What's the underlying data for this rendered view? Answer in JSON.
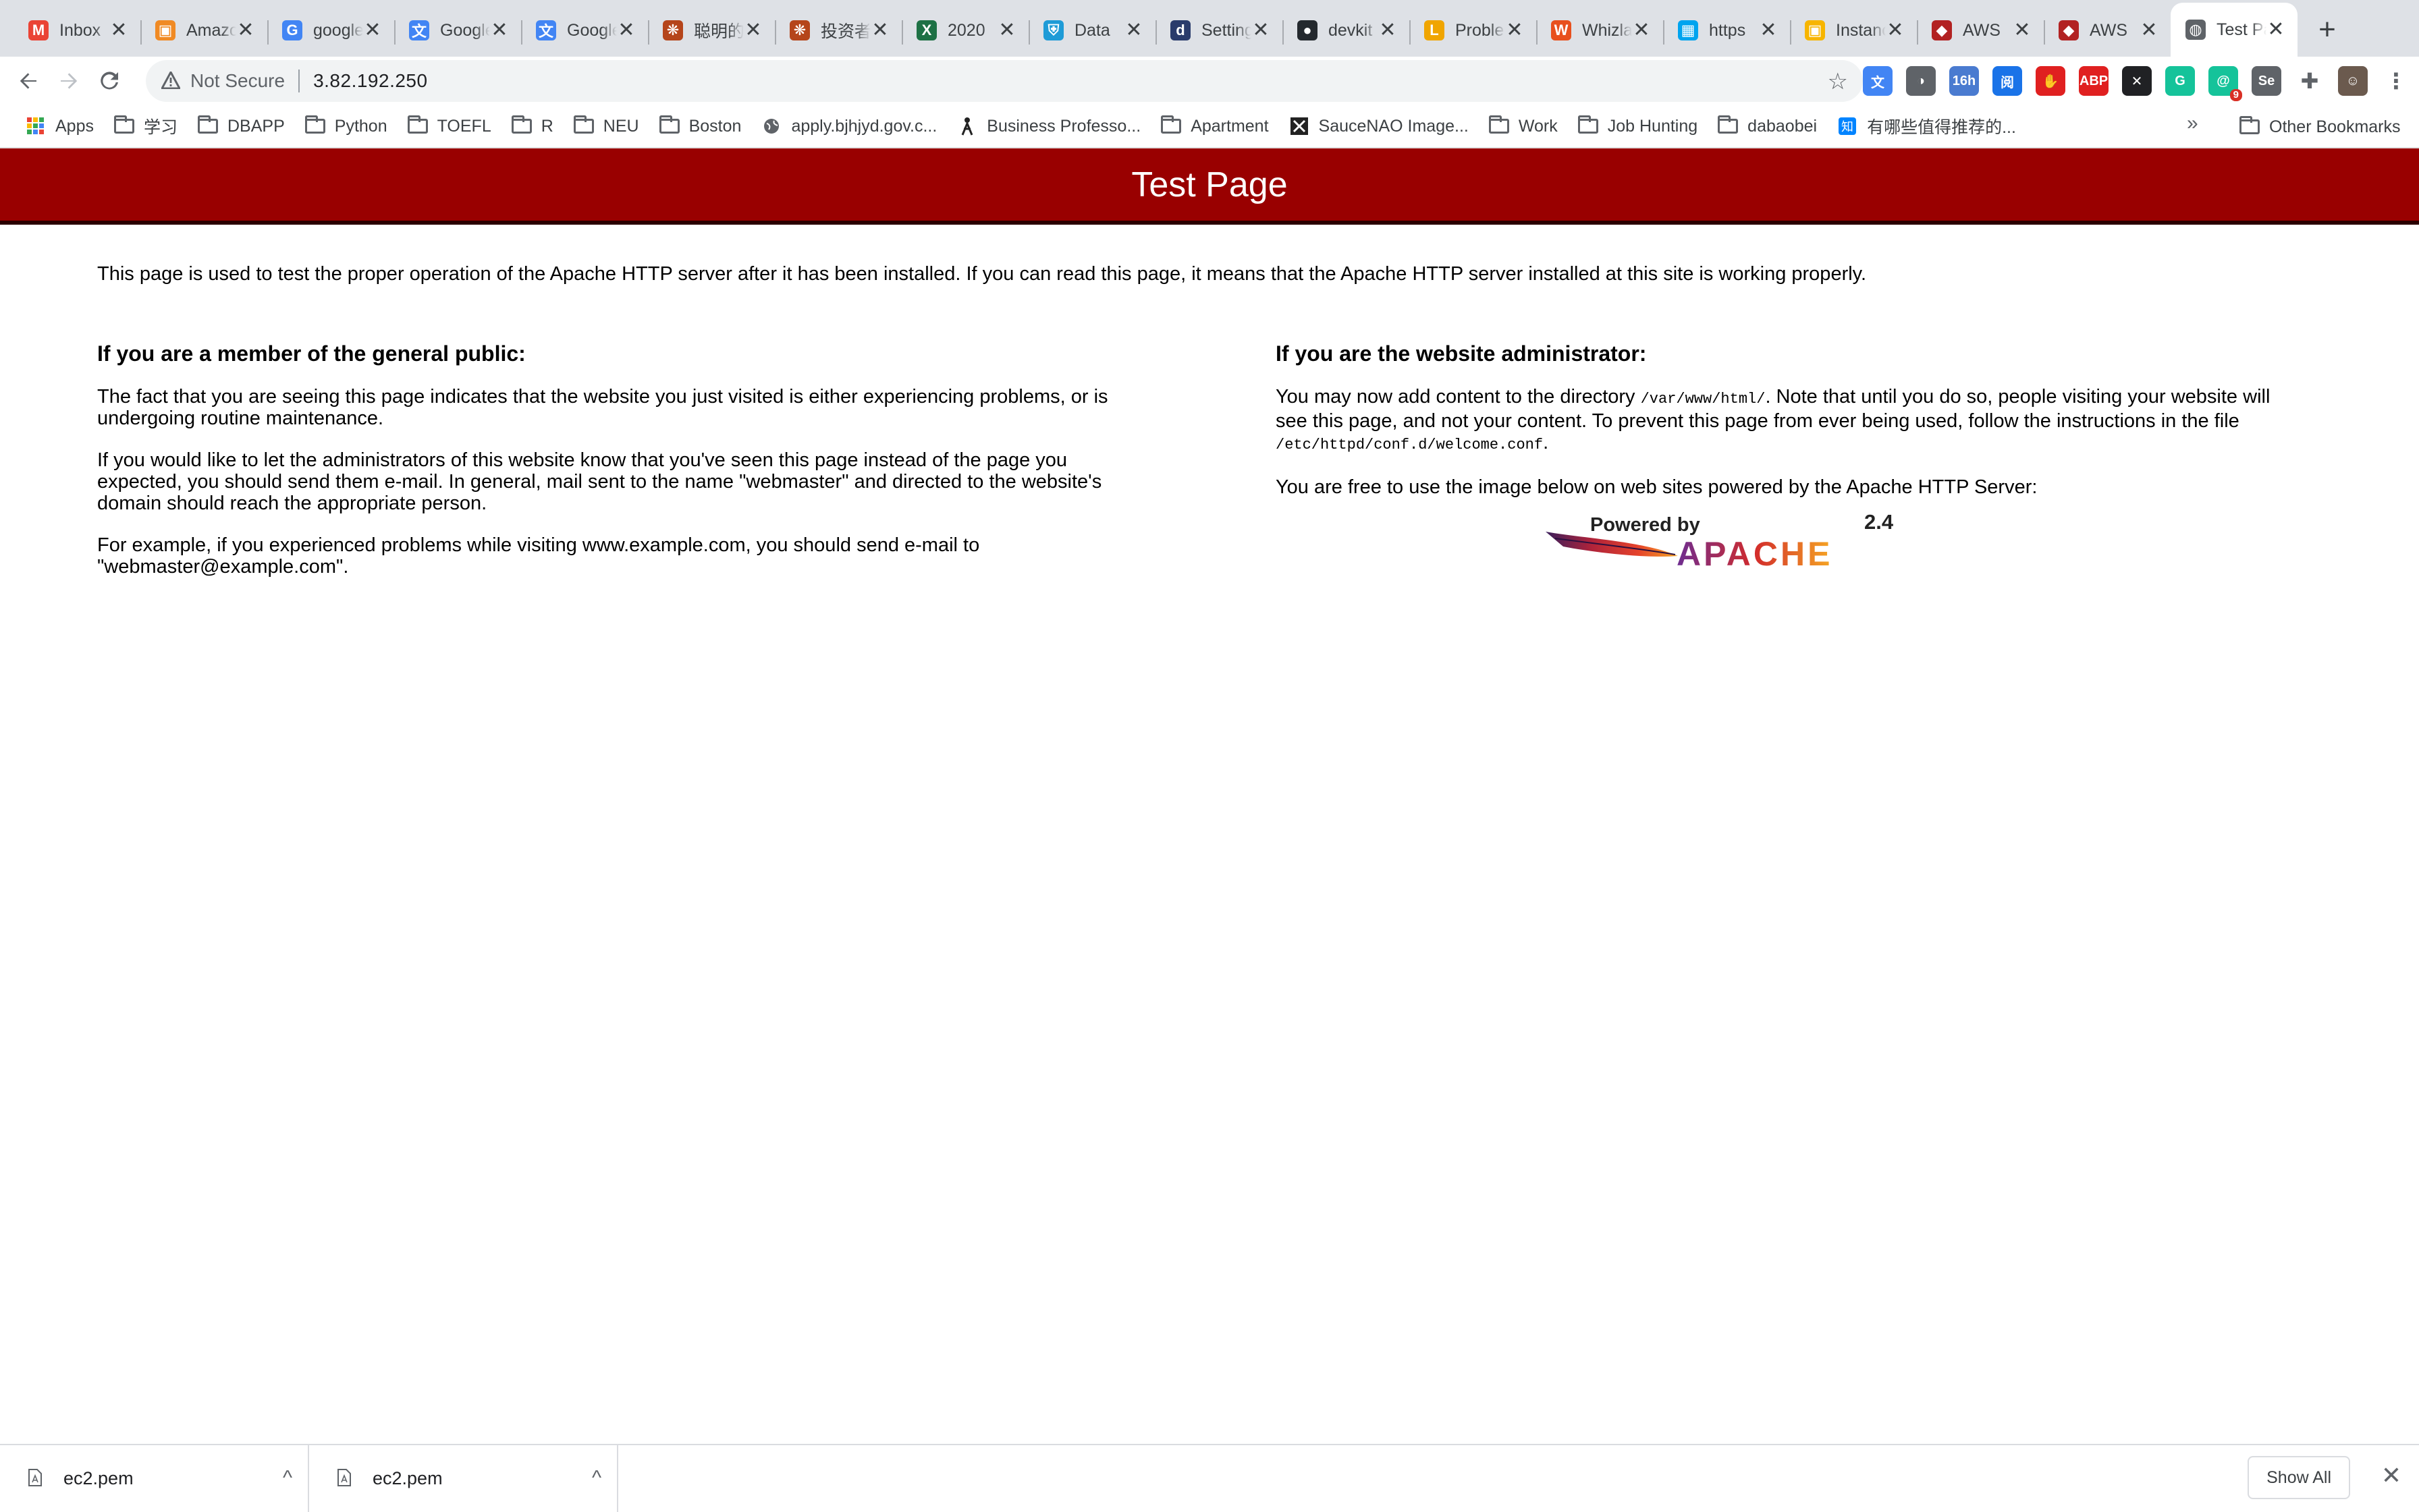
{
  "browser": {
    "tabs": [
      {
        "title": "Inbox",
        "icon": "gmail-icon",
        "color": "#ea4335",
        "glyph": "M"
      },
      {
        "title": "Amazon",
        "icon": "aws-box-icon",
        "color": "#f08a24",
        "glyph": "▣"
      },
      {
        "title": "google",
        "icon": "google-icon",
        "color": "#4285f4",
        "glyph": "G"
      },
      {
        "title": "Google Translate",
        "icon": "translate-icon",
        "color": "#4285f4",
        "glyph": "文"
      },
      {
        "title": "Google Translate",
        "icon": "translate-icon",
        "color": "#4285f4",
        "glyph": "文"
      },
      {
        "title": "聪明的投资者",
        "icon": "snowball-icon",
        "color": "#b5451b",
        "glyph": "❋"
      },
      {
        "title": "投资者",
        "icon": "snowball-icon",
        "color": "#b5451b",
        "glyph": "❋"
      },
      {
        "title": "2020",
        "icon": "excel-icon",
        "color": "#1e7145",
        "glyph": "X"
      },
      {
        "title": "Data",
        "icon": "shield-icon",
        "color": "#1e9bd7",
        "glyph": "⛨"
      },
      {
        "title": "Settings",
        "icon": "settings-icon",
        "color": "#2a3b6b",
        "glyph": "d"
      },
      {
        "title": "devkit",
        "icon": "github-icon",
        "color": "#24292e",
        "glyph": "●"
      },
      {
        "title": "Problems",
        "icon": "leetcode-icon",
        "color": "#f0a500",
        "glyph": "L"
      },
      {
        "title": "Whizlabs",
        "icon": "whizlabs-icon",
        "color": "#e8501d",
        "glyph": "W"
      },
      {
        "title": "https",
        "icon": "windows-icon",
        "color": "#00a4ef",
        "glyph": "▦"
      },
      {
        "title": "Instances",
        "icon": "cube-icon",
        "color": "#f7b500",
        "glyph": "▣"
      },
      {
        "title": "AWS",
        "icon": "aws-icon",
        "color": "#b22222",
        "glyph": "◆"
      },
      {
        "title": "AWS",
        "icon": "aws-icon",
        "color": "#b22222",
        "glyph": "◆"
      },
      {
        "title": "Test Page",
        "icon": "globe-icon",
        "color": "#5f6368",
        "glyph": "◍"
      }
    ],
    "new_tab_glyph": "+",
    "close_glyph": "✕",
    "address": {
      "security_label": "Not Secure",
      "url": "3.82.192.250"
    },
    "extensions": [
      {
        "name": "translate-ext-icon",
        "color": "#4285f4",
        "glyph": "文"
      },
      {
        "name": "bulb-ext-icon",
        "color": "#5f6368",
        "glyph": "◑"
      },
      {
        "name": "calendar-ext-icon",
        "color": "#4a7bd0",
        "glyph": "16h"
      },
      {
        "name": "reader-ext-icon",
        "color": "#1a73e8",
        "glyph": "阅"
      },
      {
        "name": "stop-ext-icon",
        "color": "#e02020",
        "glyph": "✋"
      },
      {
        "name": "adblock-ext-icon",
        "color": "#e02020",
        "glyph": "ABP"
      },
      {
        "name": "x-ext-icon",
        "color": "#202124",
        "glyph": "✕"
      },
      {
        "name": "grammarly-ext-icon",
        "color": "#15c39a",
        "glyph": "G"
      },
      {
        "name": "counter-ext-icon",
        "color": "#15c39a",
        "glyph": "@",
        "badge": "9"
      },
      {
        "name": "selenium-ext-icon",
        "color": "#5f6368",
        "glyph": "Se"
      },
      {
        "name": "puzzle-icon",
        "color": "#5f6368",
        "glyph": "✚"
      },
      {
        "name": "profile-avatar",
        "color": "#6b5a4e",
        "glyph": "☺"
      },
      {
        "name": "menu-kebab-icon",
        "color": "#5f6368",
        "glyph": "⋮"
      }
    ],
    "bookmarks": [
      {
        "label": "Apps",
        "type": "apps"
      },
      {
        "label": "学习",
        "type": "folder"
      },
      {
        "label": "DBAPP",
        "type": "folder"
      },
      {
        "label": "Python",
        "type": "folder"
      },
      {
        "label": "TOEFL",
        "type": "folder"
      },
      {
        "label": "R",
        "type": "folder"
      },
      {
        "label": "NEU",
        "type": "folder"
      },
      {
        "label": "Boston",
        "type": "folder"
      },
      {
        "label": "apply.bjhjyd.gov.c...",
        "type": "globe"
      },
      {
        "label": "Business Professo...",
        "type": "figure"
      },
      {
        "label": "Apartment",
        "type": "folder"
      },
      {
        "label": "SauceNAO Image...",
        "type": "x"
      },
      {
        "label": "Work",
        "type": "folder"
      },
      {
        "label": "Job Hunting",
        "type": "folder"
      },
      {
        "label": "dabaobei",
        "type": "folder"
      },
      {
        "label": "有哪些值得推荐的...",
        "type": "zhihu"
      }
    ],
    "bookmarks_overflow": "»",
    "other_bookmarks": "Other Bookmarks"
  },
  "page": {
    "title": "Test Page",
    "intro": "This page is used to test the proper operation of the Apache HTTP server after it has been installed. If you can read this page, it means that the Apache HTTP server installed at this site is working properly.",
    "public": {
      "heading": "If you are a member of the general public:",
      "p1": "The fact that you are seeing this page indicates that the website you just visited is either experiencing problems, or is undergoing routine maintenance.",
      "p2": "If you would like to let the administrators of this website know that you've seen this page instead of the page you expected, you should send them e-mail. In general, mail sent to the name \"webmaster\" and directed to the website's domain should reach the appropriate person.",
      "p3": "For example, if you experienced problems while visiting www.example.com, you should send e-mail to \"webmaster@example.com\"."
    },
    "admin": {
      "heading": "If you are the website administrator:",
      "p1_a": "You may now add content to the directory ",
      "p1_dir": "/var/www/html/",
      "p1_b": ". Note that until you do so, people visiting your website will see this page, and not your content. To prevent this page from ever being used, follow the instructions in the file ",
      "p1_file": "/etc/httpd/conf.d/welcome.conf",
      "p1_c": ".",
      "p2": "You are free to use the image below on web sites powered by the Apache HTTP Server:",
      "logo": {
        "powered_by": "Powered by",
        "name": "APACHE",
        "version": "2.4"
      }
    }
  },
  "downloads": {
    "items": [
      {
        "name": "ec2.pem"
      },
      {
        "name": "ec2.pem"
      }
    ],
    "show_all": "Show All",
    "expand_glyph": "^",
    "close_glyph": "✕"
  }
}
